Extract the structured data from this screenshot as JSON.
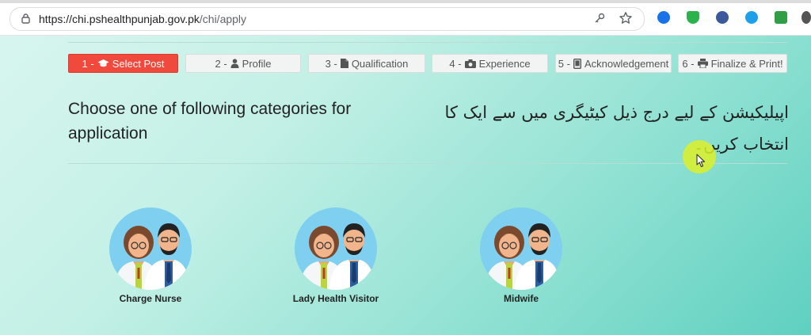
{
  "browser": {
    "url_host": "https://chi.pshealthpunjab.gov.pk",
    "url_path": "/chi/apply"
  },
  "steps": [
    {
      "label": "1 - Select Post",
      "num": "1 -",
      "text": "Select Post",
      "icon": "graduation-cap-icon",
      "active": true
    },
    {
      "label": "2 - Profile",
      "num": "2 -",
      "text": "Profile",
      "icon": "user-icon",
      "active": false
    },
    {
      "label": "3 - Qualification",
      "num": "3 -",
      "text": "Qualification",
      "icon": "file-icon",
      "active": false
    },
    {
      "label": "4 - Experience",
      "num": "4 -",
      "text": "Experience",
      "icon": "camera-icon",
      "active": false
    },
    {
      "label": "5 - Acknowledgement",
      "num": "5 -",
      "text": "Acknowledgement",
      "icon": "tablet-icon",
      "active": false
    },
    {
      "label": "6 - Finalize & Print!",
      "num": "6 -",
      "text": "Finalize & Print!",
      "icon": "printer-icon",
      "active": false
    }
  ],
  "heading": {
    "english": "Choose one of following categories for application",
    "urdu": "اپیلیکیشن کے لیے درج ذیل کیٹیگری میں سے ایک کا انتخاب کریں۔"
  },
  "categories": [
    {
      "label": "Charge Nurse"
    },
    {
      "label": "Lady Health Visitor"
    },
    {
      "label": "Midwife"
    }
  ],
  "colors": {
    "active_step": "#f04a3d",
    "avatar_bg": "#7ecff0",
    "cursor_highlight": "#ddf028"
  }
}
